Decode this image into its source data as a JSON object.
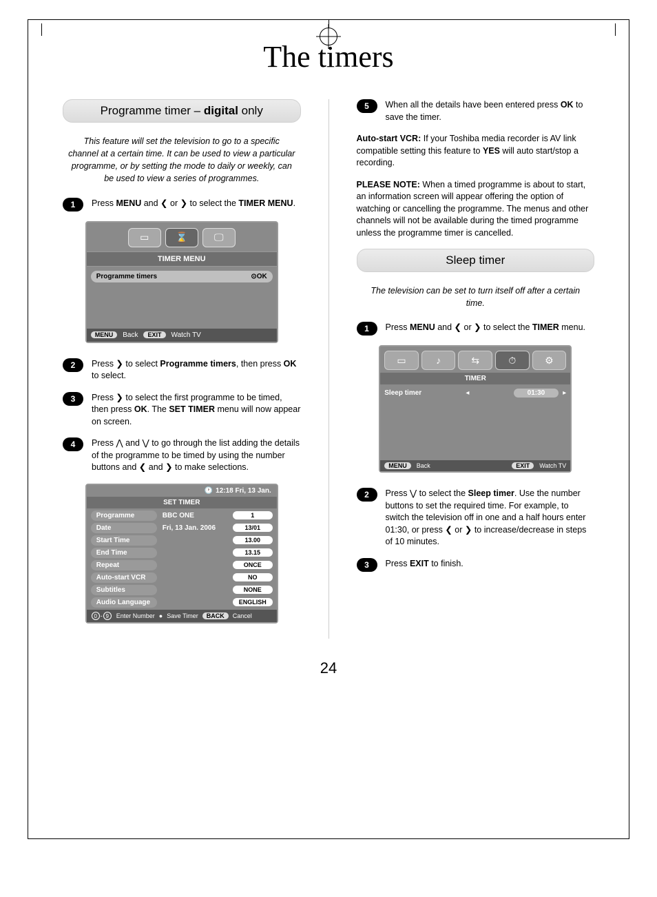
{
  "page": {
    "number": "24",
    "title": "The timers"
  },
  "left": {
    "section_title_pre": "Programme timer – ",
    "section_title_bold": "digital",
    "section_title_post": " only",
    "intro": "This feature will set the television to go to a specific channel at a certain time. It can be used to view a particular programme, or by setting the mode to daily or weekly, can be used to view a series of programmes.",
    "step1_a": "Press ",
    "step1_b": "MENU",
    "step1_c": " and ❮ or ❯ to select the ",
    "step1_d": "TIMER MENU",
    "step1_e": ".",
    "osd1": {
      "title": "TIMER MENU",
      "row_label": "Programme timers",
      "row_right": "OK",
      "foot_menu": "MENU",
      "foot_back": "Back",
      "foot_exit": "EXIT",
      "foot_watch": "Watch TV"
    },
    "step2_a": "Press ❯ to select ",
    "step2_b": "Programme timers",
    "step2_c": ", then press ",
    "step2_d": "OK",
    "step2_e": " to select.",
    "step3_a": "Press ❯ to select the first programme to be timed, then press ",
    "step3_b": "OK",
    "step3_c": ". The ",
    "step3_d": "SET TIMER",
    "step3_e": " menu will now appear on screen.",
    "step4": "Press ⋀ and ⋁ to go through the list adding the details of the programme to be timed by using the number buttons and ❮ and ❯ to make selections.",
    "osd2": {
      "clock": "12:18 Fri, 13 Jan.",
      "title": "SET TIMER",
      "rows": [
        {
          "label": "Programme",
          "mid": "BBC ONE",
          "val": "1"
        },
        {
          "label": "Date",
          "mid": "Fri, 13 Jan. 2006",
          "val": "13/01"
        },
        {
          "label": "Start Time",
          "mid": "",
          "val": "13.00"
        },
        {
          "label": "End Time",
          "mid": "",
          "val": "13.15"
        },
        {
          "label": "Repeat",
          "mid": "",
          "val": "ONCE"
        },
        {
          "label": "Auto-start VCR",
          "mid": "",
          "val": "NO"
        },
        {
          "label": "Subtitles",
          "mid": "",
          "val": "NONE"
        },
        {
          "label": "Audio Language",
          "mid": "",
          "val": "ENGLISH"
        }
      ],
      "foot_enter": "Enter Number",
      "foot_save": "Save Timer",
      "foot_back_pill": "BACK",
      "foot_cancel": "Cancel"
    }
  },
  "right": {
    "step5_a": "When all the details have been entered press ",
    "step5_b": "OK",
    "step5_c": " to save the timer.",
    "p1_a": "Auto-start VCR:",
    "p1_b": " If your Toshiba media recorder is AV link compatible setting this feature to ",
    "p1_c": "YES",
    "p1_d": " will auto start/stop a recording.",
    "p2_a": "PLEASE NOTE:",
    "p2_b": " When a timed programme is about to start, an information screen will appear offering the option of watching or cancelling the programme. The menus and other channels will not be available during the timed programme unless the programme timer is cancelled.",
    "section2": "Sleep timer",
    "intro2": "The television can be set to turn itself off after a certain time.",
    "s2_step1_a": "Press ",
    "s2_step1_b": "MENU",
    "s2_step1_c": " and ❮ or ❯ to select the ",
    "s2_step1_d": "TIMER",
    "s2_step1_e": " menu.",
    "osd3": {
      "title": "TIMER",
      "row_label": "Sleep timer",
      "row_val": "01:30",
      "foot_menu": "MENU",
      "foot_back": "Back",
      "foot_exit": "EXIT",
      "foot_watch": "Watch TV"
    },
    "s2_step2_a": "Press ⋁ to select the ",
    "s2_step2_b": "Sleep timer",
    "s2_step2_c": ". Use the number buttons to set the required time. For example, to switch the television off in one and a half hours enter 01:30, or press ❮ or ❯ to increase/decrease in steps of 10 minutes.",
    "s2_step3_a": "Press ",
    "s2_step3_b": "EXIT",
    "s2_step3_c": " to finish."
  }
}
